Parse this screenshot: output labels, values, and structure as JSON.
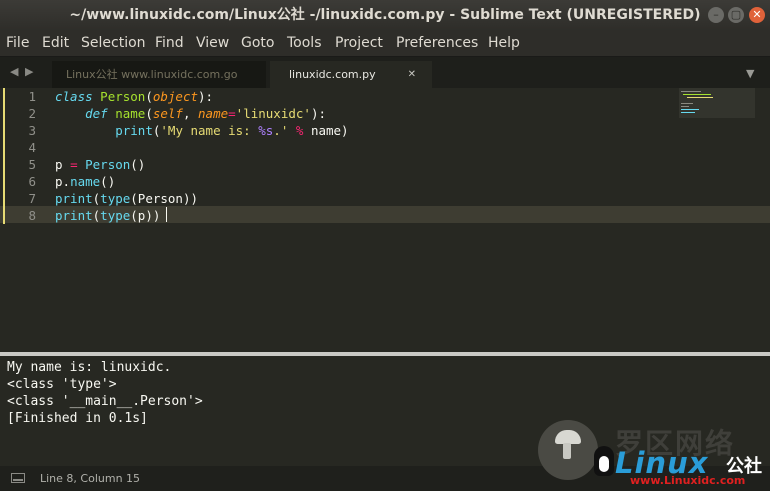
{
  "window": {
    "title": "~/www.linuxidc.com/Linux公社 -/linuxidc.com.py - Sublime Text (UNREGISTERED)",
    "controls": [
      "minimize",
      "maximize",
      "close"
    ]
  },
  "menu": [
    "File",
    "Edit",
    "Selection",
    "Find",
    "View",
    "Goto",
    "Tools",
    "Project",
    "Preferences",
    "Help"
  ],
  "tabs": [
    {
      "label": "Linux公社 www.linuxidc.com.go",
      "active": false
    },
    {
      "label": "linuxidc.com.py",
      "active": true,
      "close": "✕"
    }
  ],
  "editor": {
    "line_numbers": [
      "1",
      "2",
      "3",
      "4",
      "5",
      "6",
      "7",
      "8"
    ],
    "lines": [
      {
        "t1": "class",
        "t2": " ",
        "t3": "Person",
        "t4": "(",
        "t5": "object",
        "t6": "):"
      },
      {
        "t1": "    ",
        "t2": "def",
        "t3": " ",
        "t4": "name",
        "t5": "(",
        "t6": "self",
        "t7": ", ",
        "t8": "name",
        "t9": "=",
        "t10": "'linuxidc'",
        "t11": "):"
      },
      {
        "t1": "        ",
        "t2": "print",
        "t3": "(",
        "t4": "'My name is: ",
        "t5": "%s",
        "t6": ".'",
        "t7": " ",
        "t8": "%",
        "t9": " name)"
      },
      {},
      {
        "t1": "p ",
        "t2": "=",
        "t3": " ",
        "t4": "Person",
        "t5": "()"
      },
      {
        "t1": "p.",
        "t2": "name",
        "t3": "()"
      },
      {
        "t1": "print",
        "t2": "(",
        "t3": "type",
        "t4": "(Person))"
      },
      {
        "t1": "print",
        "t2": "(",
        "t3": "type",
        "t4": "(p))"
      }
    ],
    "colors": {
      "keyword": "#66d9ef",
      "class_name": "#a6e22e",
      "string": "#e6db74",
      "operator": "#f92672",
      "param": "#fd971f",
      "format": "#ae81ff"
    }
  },
  "output": {
    "lines": [
      "My name is: linuxidc.",
      "<class 'type'>",
      "<class '__main__.Person'>",
      "[Finished in 0.1s]"
    ]
  },
  "watermark": {
    "cn": "罗区网络",
    "logo": "Linux",
    "cn2": "公社",
    "url": "www.Linuxidc.com"
  },
  "status": {
    "position": "Line 8, Column 15"
  }
}
